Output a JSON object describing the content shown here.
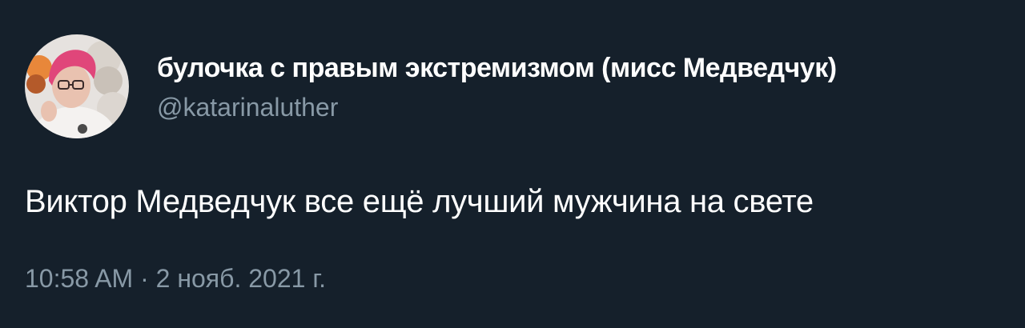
{
  "tweet": {
    "author": {
      "display_name": "булочка с правым экстремизмом (мисс Медведчук)",
      "handle": "@katarinaluther",
      "avatar_icon": "profile-avatar"
    },
    "text": "Виктор Медведчук все ещё лучший мужчина на свете",
    "timestamp": "10:58 AM · 2 нояб. 2021 г."
  },
  "colors": {
    "background": "#15202b",
    "primary_text": "#ffffff",
    "secondary_text": "#8899a6"
  }
}
